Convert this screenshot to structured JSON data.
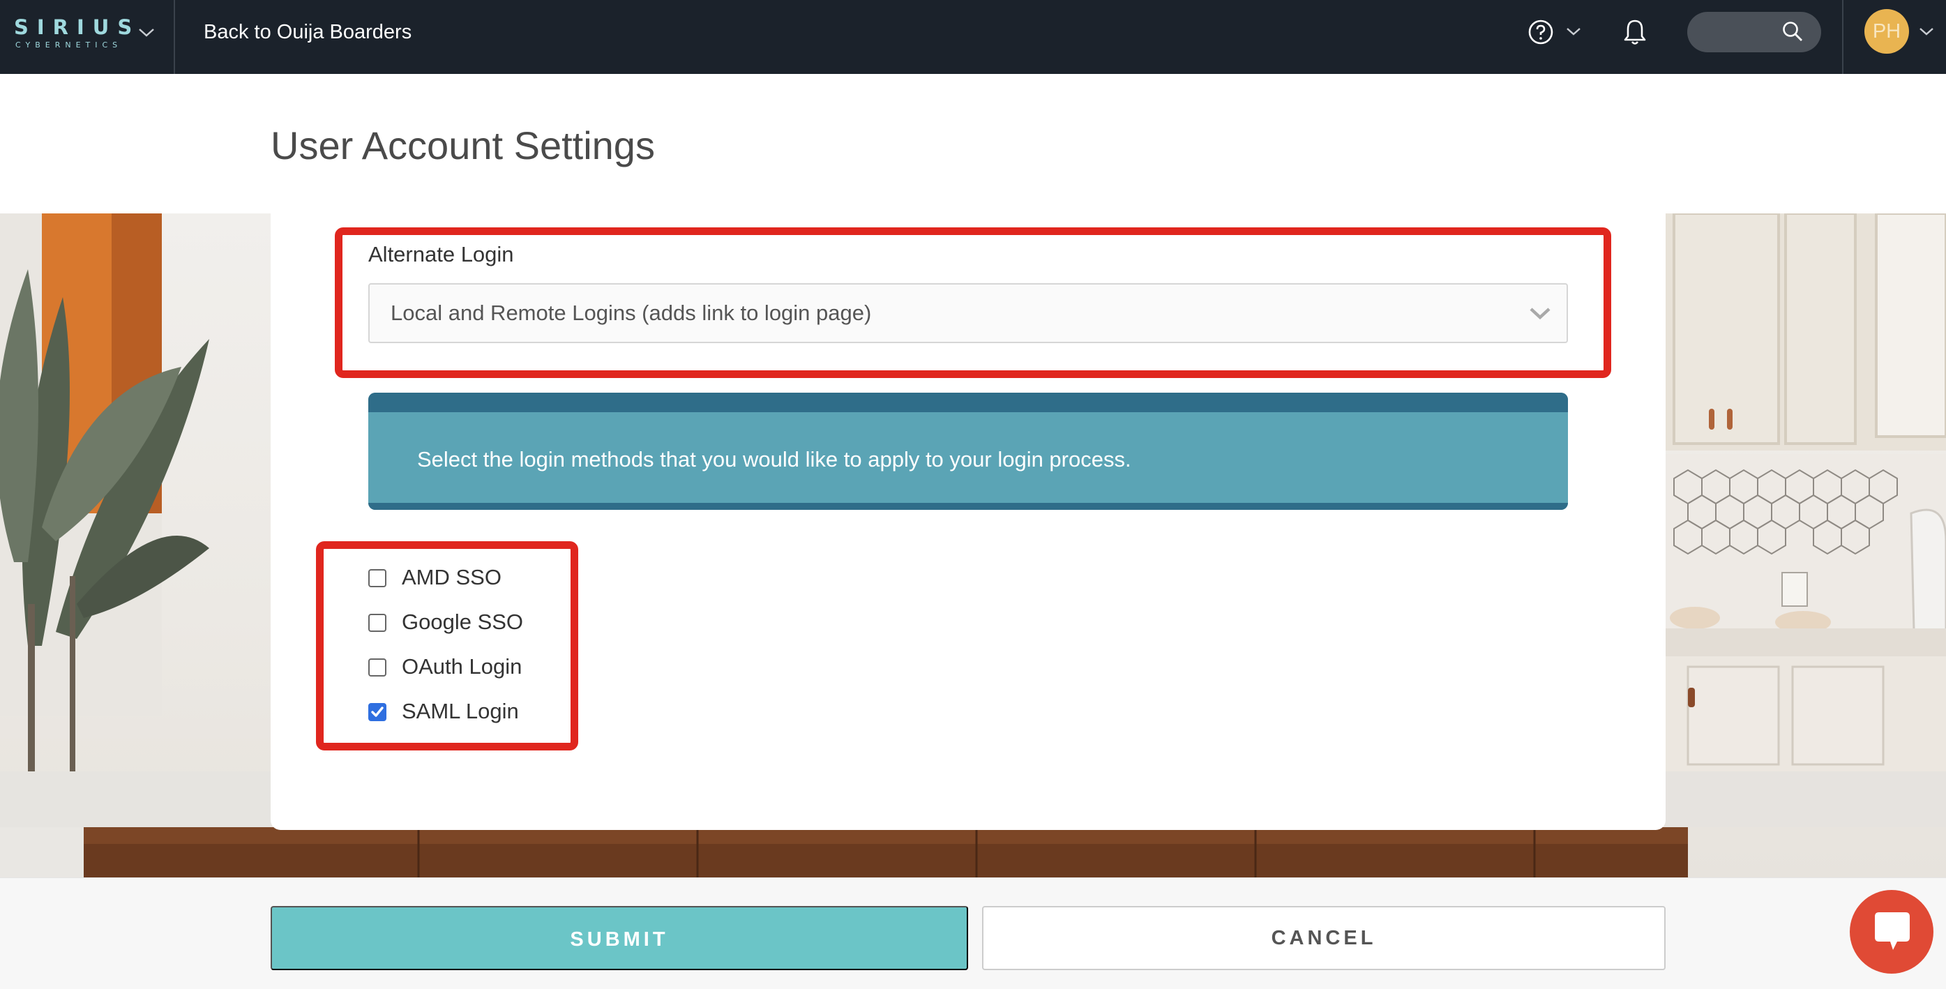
{
  "topbar": {
    "logo_line1": "SIRIUS",
    "logo_line2": "CYBERNETICS",
    "back_link": "Back to Ouija Boarders",
    "avatar_initials": "PH",
    "icons": [
      "chevron-down-icon",
      "help-icon",
      "bell-icon",
      "search-icon"
    ]
  },
  "header": {
    "title": "User Account Settings"
  },
  "form": {
    "alternate_login_label": "Alternate Login",
    "alternate_login_value": "Local and Remote Logins (adds link to login page)",
    "info_text": "Select the login methods that you would like to apply to your login process.",
    "methods": [
      {
        "label": "AMD SSO",
        "checked": false
      },
      {
        "label": "Google SSO",
        "checked": false
      },
      {
        "label": "OAuth Login",
        "checked": false
      },
      {
        "label": "SAML Login",
        "checked": true
      }
    ]
  },
  "footer": {
    "submit_label": "SUBMIT",
    "cancel_label": "CANCEL"
  },
  "colors": {
    "topbar": "#1b222b",
    "highlight": "#e0261e",
    "info_box": "#5ba4b5",
    "info_box_stripe": "#2f6d89",
    "submit": "#6bc5c7",
    "avatar": "#e9b451",
    "chat": "#e04a35",
    "checkbox_checked": "#2f6fe0"
  }
}
